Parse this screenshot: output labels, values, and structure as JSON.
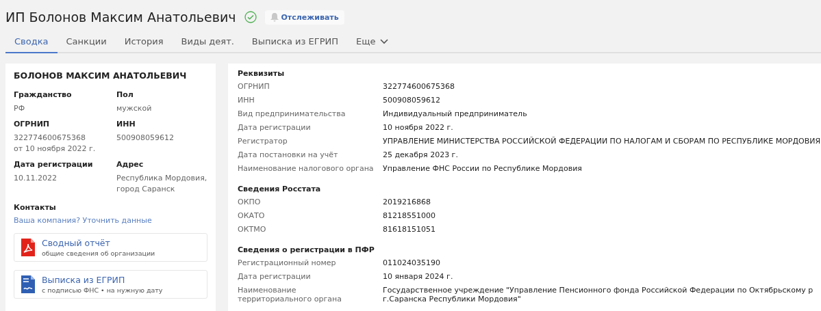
{
  "header": {
    "title": "ИП Болонов Максим Анатольевич",
    "verified": true,
    "follow_button": "Отслеживать"
  },
  "tabs": [
    {
      "label": "Сводка",
      "selected": true
    },
    {
      "label": "Санкции",
      "selected": false
    },
    {
      "label": "История",
      "selected": false
    },
    {
      "label": "Виды деят.",
      "selected": false
    },
    {
      "label": "Выписка из ЕГРИП",
      "selected": false
    },
    {
      "label": "Еще",
      "selected": false,
      "kind": "dropdown"
    }
  ],
  "summary_card": {
    "name": "БОЛОНОВ МАКСИМ АНАТОЛЬЕВИЧ",
    "fields": [
      {
        "label": "Гражданство",
        "value": "РФ"
      },
      {
        "label": "Пол",
        "value": "мужской"
      },
      {
        "label": "ОГРНИП",
        "value": "322774600675368",
        "note": "от 10 ноября 2022 г."
      },
      {
        "label": "ИНН",
        "value": "500908059612"
      },
      {
        "label": "Дата регистрации",
        "value": "10.11.2022"
      },
      {
        "label": "Адрес",
        "value": "Республика Мордовия, город Саранск"
      }
    ],
    "contacts_label": "Контакты",
    "contacts_link": "Ваша компания? Уточнить данные",
    "documents": [
      {
        "kind": "pdf",
        "title": "Сводный отчёт",
        "subtitle": "общие сведения об организации"
      },
      {
        "kind": "doc",
        "title": "Выписка из ЕГРИП",
        "subtitle": "с подписью ФНС • на нужную дату"
      }
    ]
  },
  "details": [
    {
      "title": "Реквизиты",
      "rows": [
        {
          "label": "ОГРНИП",
          "value": "322774600675368"
        },
        {
          "label": "ИНН",
          "value": "500908059612"
        },
        {
          "label": "Вид предпринимательства",
          "value": "Индивидуальный предприниматель"
        },
        {
          "label": "Дата регистрации",
          "value": "10 ноября 2022 г."
        },
        {
          "label": "Регистратор",
          "value": "УПРАВЛЕНИЕ МИНИСТЕРСТВА РОССИЙСКОЙ ФЕДЕРАЦИИ ПО НАЛОГАМ И СБОРАМ ПО РЕСПУБЛИКЕ МОРДОВИЯ"
        },
        {
          "label": "Дата постановки на учёт",
          "value": "25 декабря 2023 г."
        },
        {
          "label": "Наименование налогового органа",
          "value": "Управление ФНС России по Республике Мордовия"
        }
      ]
    },
    {
      "title": "Сведения Росстата",
      "rows": [
        {
          "label": "ОКПО",
          "value": "2019216868"
        },
        {
          "label": "ОКАТО",
          "value": "81218551000"
        },
        {
          "label": "ОКТМО",
          "value": "81618151051"
        }
      ]
    },
    {
      "title": "Сведения о регистрации в ПФР",
      "rows": [
        {
          "label": "Регистрационный номер",
          "value": "011024035190"
        },
        {
          "label": "Дата регистрации",
          "value": "10 января 2024 г."
        },
        {
          "label": "Наименование территориального органа",
          "value": "Государственное учреждение \"Управление Пенсионного фонда Российской Федерации по Октябрьскому р г.Саранска Республики Мордовия\""
        }
      ]
    }
  ]
}
